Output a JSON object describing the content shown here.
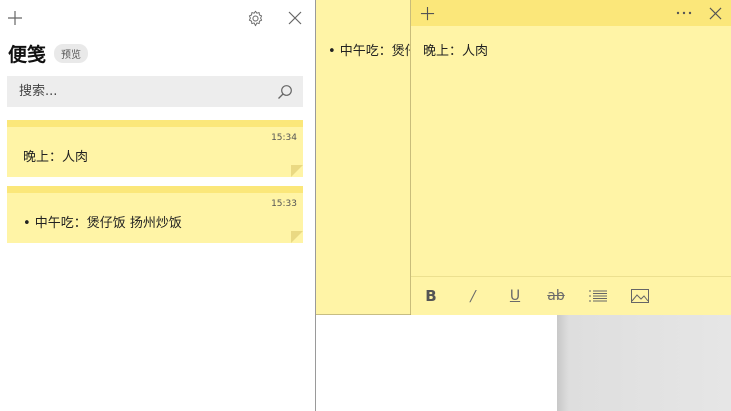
{
  "list": {
    "title": "便笺",
    "badge": "预览",
    "search": {
      "placeholder": "搜索..."
    },
    "notes": [
      {
        "time": "15:34",
        "text": "晚上：人肉"
      },
      {
        "time": "15:33",
        "text": "• 中午吃：煲仔饭  扬州炒饭"
      }
    ]
  },
  "bg_note": {
    "text": "• 中午吃：煲仔饭"
  },
  "front_note": {
    "text": "晚上：人肉"
  },
  "toolbar": {
    "bold": "B",
    "italic": "/",
    "underline": "U",
    "strike": "ab"
  },
  "colors": {
    "note_yellow": "#fff4a6",
    "note_header": "#fbe77a"
  },
  "icons": [
    "plus-icon",
    "gear-icon",
    "close-icon",
    "search-icon",
    "more-icon",
    "list-icon",
    "image-icon"
  ]
}
